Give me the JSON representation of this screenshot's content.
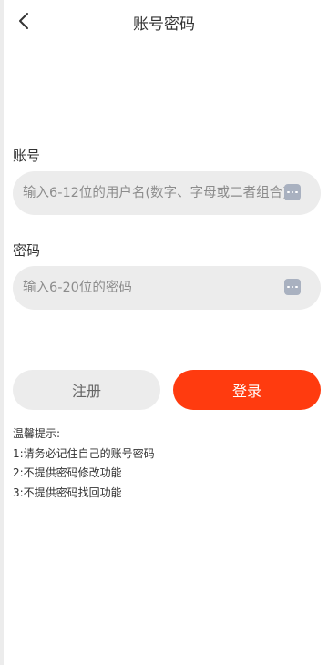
{
  "nav": {
    "title": "账号密码",
    "back_icon": "chevron-left-icon"
  },
  "account": {
    "label": "账号",
    "placeholder": "输入6-12位的用户名(数字、字母或二者组合)",
    "value": ""
  },
  "password": {
    "label": "密码",
    "placeholder": "输入6-20位的密码",
    "value": ""
  },
  "keyboard_icon": "more-dots-icon",
  "buttons": {
    "register_label": "注册",
    "login_label": "登录"
  },
  "tips": {
    "title": "温馨提示:",
    "lines": [
      "1:请务必记住自己的账号密码",
      "2:不提供密码修改功能",
      "3:不提供密码找回功能"
    ]
  },
  "colors": {
    "primary": "#ff3b0f",
    "input_bg": "#ececec",
    "icon_bg": "#a9b1c0",
    "text": "#333333"
  }
}
